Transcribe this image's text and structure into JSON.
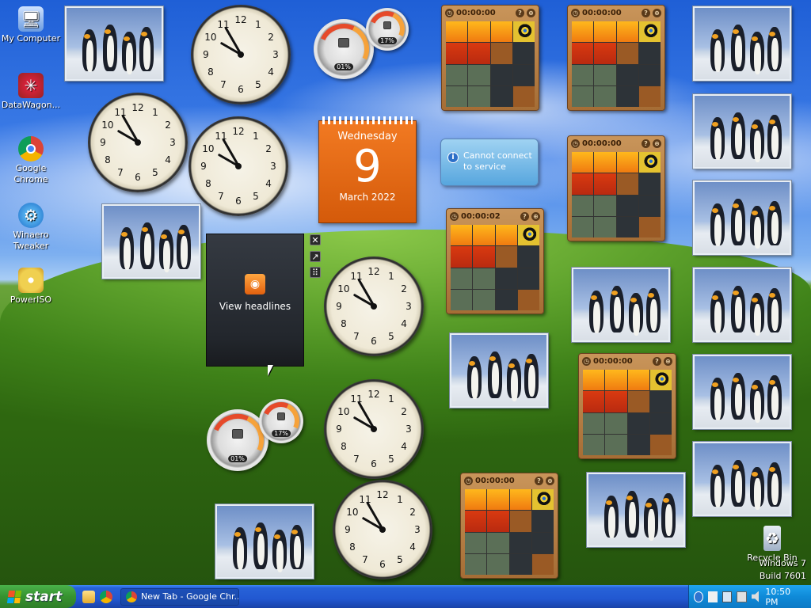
{
  "desktop": {
    "icons": [
      {
        "label": "My Computer",
        "icon": "computer-icon"
      },
      {
        "label": "DataWagon...",
        "icon": "datawagon-shortcut-icon"
      },
      {
        "label": "Google Chrome",
        "icon": "chrome-icon"
      },
      {
        "label": "Winaero Tweaker",
        "icon": "winaero-tweaker-icon"
      },
      {
        "label": "PowerISO",
        "icon": "poweriso-icon"
      },
      {
        "label": "Recycle Bin",
        "icon": "recycle-bin-icon"
      }
    ],
    "watermark": {
      "line1": "Windows 7",
      "line2": "Build 7601"
    }
  },
  "gadgets": {
    "calendar": {
      "weekday": "Wednesday",
      "day": "9",
      "month_year": "March 2022"
    },
    "weather": {
      "message": "Cannot connect to service"
    },
    "feed": {
      "label": "View headlines",
      "close": "✕",
      "expand": "↗",
      "drag": "⠿"
    },
    "cpu_meter": {
      "cpu_percent": "01%",
      "memory_percent": "17%"
    },
    "puzzles": [
      {
        "timer": "00:00:00",
        "help": "?",
        "play": "⊕"
      },
      {
        "timer": "00:00:00",
        "help": "?",
        "play": "⊕"
      },
      {
        "timer": "00:00:00",
        "help": "?",
        "play": "⊕"
      },
      {
        "timer": "00:00:02",
        "help": "?",
        "play": "⊕"
      },
      {
        "timer": "00:00:00",
        "help": "?",
        "play": "⊕"
      },
      {
        "timer": "00:00:00",
        "help": "?",
        "play": "⊕"
      }
    ],
    "clock_numbers": [
      "12",
      "1",
      "2",
      "3",
      "4",
      "5",
      "6",
      "7",
      "8",
      "9",
      "10",
      "11"
    ]
  },
  "taskbar": {
    "start_label": "start",
    "task_label": "New Tab - Google Chr...",
    "time": "10:50 PM"
  },
  "colors": {
    "taskbar": "#2258d1",
    "start": "#36922f",
    "tray": "#0f8ad8",
    "calendar": "#e8691a"
  }
}
